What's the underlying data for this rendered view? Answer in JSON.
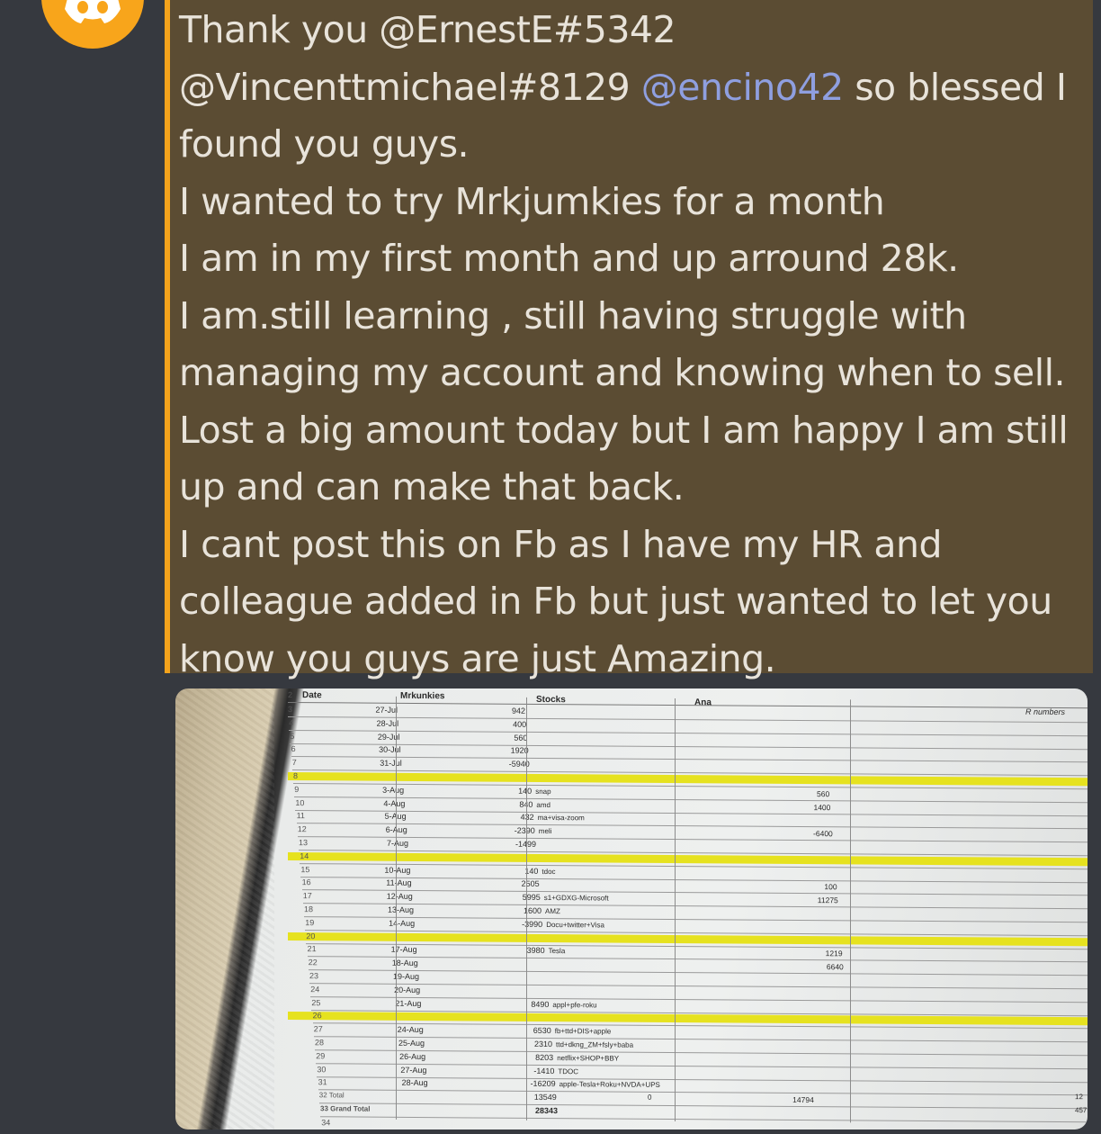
{
  "message": {
    "lines": [
      [
        {
          "t": "Thank you @ErnestE#5342",
          "m": false
        }
      ],
      [
        {
          "t": "@Vincenttmichael#8129 ",
          "m": false
        },
        {
          "t": "@encino42",
          "m": true
        },
        {
          "t": "  so blessed I",
          "m": false
        }
      ],
      [
        {
          "t": "found you guys.",
          "m": false
        }
      ],
      [
        {
          "t": "I wanted to try Mrkjumkies for a month",
          "m": false
        }
      ],
      [
        {
          "t": "I am in my first month and up arround 28k.",
          "m": false
        }
      ],
      [
        {
          "t": "I am.still learning , still having struggle with",
          "m": false
        }
      ],
      [
        {
          "t": "managing my account and knowing when to sell.",
          "m": false
        }
      ],
      [
        {
          "t": "Lost a big amount today but I am happy I am still",
          "m": false
        }
      ],
      [
        {
          "t": "up and can make that back.",
          "m": false
        }
      ],
      [
        {
          "t": "I cant post this on Fb as I have my HR and",
          "m": false
        }
      ],
      [
        {
          "t": "colleague added in Fb but just wanted to let you",
          "m": false
        }
      ],
      [
        {
          "t": "know you guys are  just Amazing.",
          "m": false
        }
      ]
    ]
  },
  "colors": {
    "quote_bg": "#5b4c33",
    "quote_border": "#f4a31c",
    "mention": "#8f9fe0",
    "avatar": "#f8a51b"
  },
  "avatar_icon": "discord-logo",
  "spreadsheet": {
    "headers": {
      "rownum": "2",
      "date": "Date",
      "mrk": "Mrkunkies",
      "stocks": "Stocks",
      "ana": "Ana",
      "rnum": "R numbers"
    },
    "rows": [
      {
        "n": "3",
        "d": "27-Jul",
        "v": "942",
        "s": "",
        "r": ""
      },
      {
        "n": "4",
        "d": "28-Jul",
        "v": "400",
        "s": "",
        "r": ""
      },
      {
        "n": "5",
        "d": "29-Jul",
        "v": "560",
        "s": "",
        "r": ""
      },
      {
        "n": "6",
        "d": "30-Jul",
        "v": "1920",
        "s": "",
        "r": ""
      },
      {
        "n": "7",
        "d": "31-Jul",
        "v": "-5940",
        "s": "",
        "r": ""
      },
      {
        "n": "8",
        "d": "",
        "v": "",
        "s": "",
        "r": "",
        "hl": true
      },
      {
        "n": "9",
        "d": "3-Aug",
        "v": "140",
        "s": "snap",
        "r": "560"
      },
      {
        "n": "10",
        "d": "4-Aug",
        "v": "840",
        "s": "amd",
        "r": "1400"
      },
      {
        "n": "11",
        "d": "5-Aug",
        "v": "432",
        "s": "ma+visa-zoom",
        "r": ""
      },
      {
        "n": "12",
        "d": "6-Aug",
        "v": "-2390",
        "s": "meli",
        "r": "-6400"
      },
      {
        "n": "13",
        "d": "7-Aug",
        "v": "-1499",
        "s": "",
        "r": ""
      },
      {
        "n": "14",
        "d": "",
        "v": "",
        "s": "",
        "r": "",
        "hl": true
      },
      {
        "n": "15",
        "d": "10-Aug",
        "v": "140",
        "s": "tdoc",
        "r": ""
      },
      {
        "n": "16",
        "d": "11-Aug",
        "v": "2505",
        "s": "",
        "r": "100"
      },
      {
        "n": "17",
        "d": "12-Aug",
        "v": "5995",
        "s": "s1+GDXG-Microsoft",
        "r": "11275"
      },
      {
        "n": "18",
        "d": "13-Aug",
        "v": "1600",
        "s": "AMZ",
        "r": ""
      },
      {
        "n": "19",
        "d": "14-Aug",
        "v": "-3990",
        "s": "Docu+twitter+Visa",
        "r": ""
      },
      {
        "n": "20",
        "d": "",
        "v": "",
        "s": "",
        "r": "",
        "hl": true
      },
      {
        "n": "21",
        "d": "17-Aug",
        "v": "3980",
        "s": "Tesla",
        "r": "1219"
      },
      {
        "n": "22",
        "d": "18-Aug",
        "v": "",
        "s": "",
        "r": "6640"
      },
      {
        "n": "23",
        "d": "19-Aug",
        "v": "",
        "s": "",
        "r": ""
      },
      {
        "n": "24",
        "d": "20-Aug",
        "v": "",
        "s": "",
        "r": ""
      },
      {
        "n": "25",
        "d": "21-Aug",
        "v": "8490",
        "s": "appl+pfe-roku",
        "r": ""
      },
      {
        "n": "26",
        "d": "",
        "v": "",
        "s": "",
        "r": "",
        "hl": true
      },
      {
        "n": "27",
        "d": "24-Aug",
        "v": "6530",
        "s": "fb+ttd+DIS+apple",
        "r": ""
      },
      {
        "n": "28",
        "d": "25-Aug",
        "v": "2310",
        "s": "ttd+dkng_ZM+fsly+baba",
        "r": ""
      },
      {
        "n": "29",
        "d": "26-Aug",
        "v": "8203",
        "s": "netflix+SHOP+BBY",
        "r": ""
      },
      {
        "n": "30",
        "d": "27-Aug",
        "v": "-1410",
        "s": "TDOC",
        "r": ""
      },
      {
        "n": "31",
        "d": "28-Aug",
        "v": "-16209",
        "s": "apple-Tesla+Roku+NVDA+UPS",
        "r": ""
      },
      {
        "n": "32 Total",
        "d": "",
        "v": "13549",
        "s": "",
        "r": "14794"
      },
      {
        "n": "33 Grand Total",
        "d": "",
        "v": "28343",
        "s": "",
        "r": ""
      },
      {
        "n": "34",
        "d": "",
        "v": "",
        "s": "",
        "r": ""
      }
    ],
    "side_cells": {
      "ana_total": "0",
      "far_right_1": "12",
      "far_right_2": "457"
    }
  }
}
